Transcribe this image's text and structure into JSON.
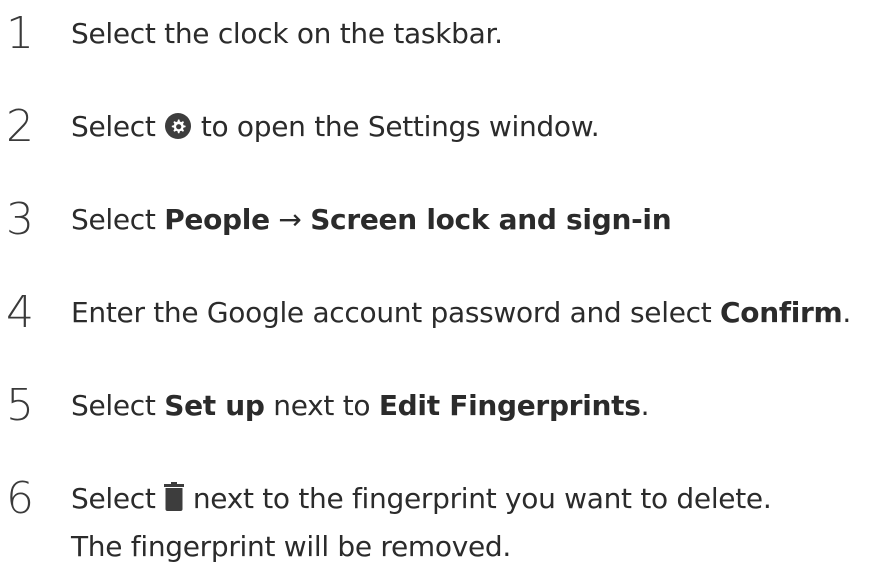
{
  "steps": [
    {
      "number": "1",
      "text": "Select the clock on the taskbar."
    },
    {
      "number": "2",
      "before_icon": "Select",
      "icon": "settings-gear-icon",
      "after_icon": "to open the Settings window."
    },
    {
      "number": "3",
      "prefix": "Select",
      "bold1": "People",
      "arrow": "→",
      "bold2": "Screen lock and sign-in"
    },
    {
      "number": "4",
      "prefix": "Enter the Google account password and select",
      "bold1": "Confirm",
      "suffix": "."
    },
    {
      "number": "5",
      "prefix": "Select",
      "bold1": "Set up",
      "middle": "next to",
      "bold2": "Edit Fingerprints",
      "suffix": "."
    },
    {
      "number": "6",
      "before_icon": "Select",
      "icon": "trash-icon",
      "after_icon": "next to the fingerprint you want to delete."
    }
  ],
  "note": "The fingerprint will be removed.",
  "colors": {
    "text": "#2b2b2b",
    "icon": "#3d3d3d"
  }
}
